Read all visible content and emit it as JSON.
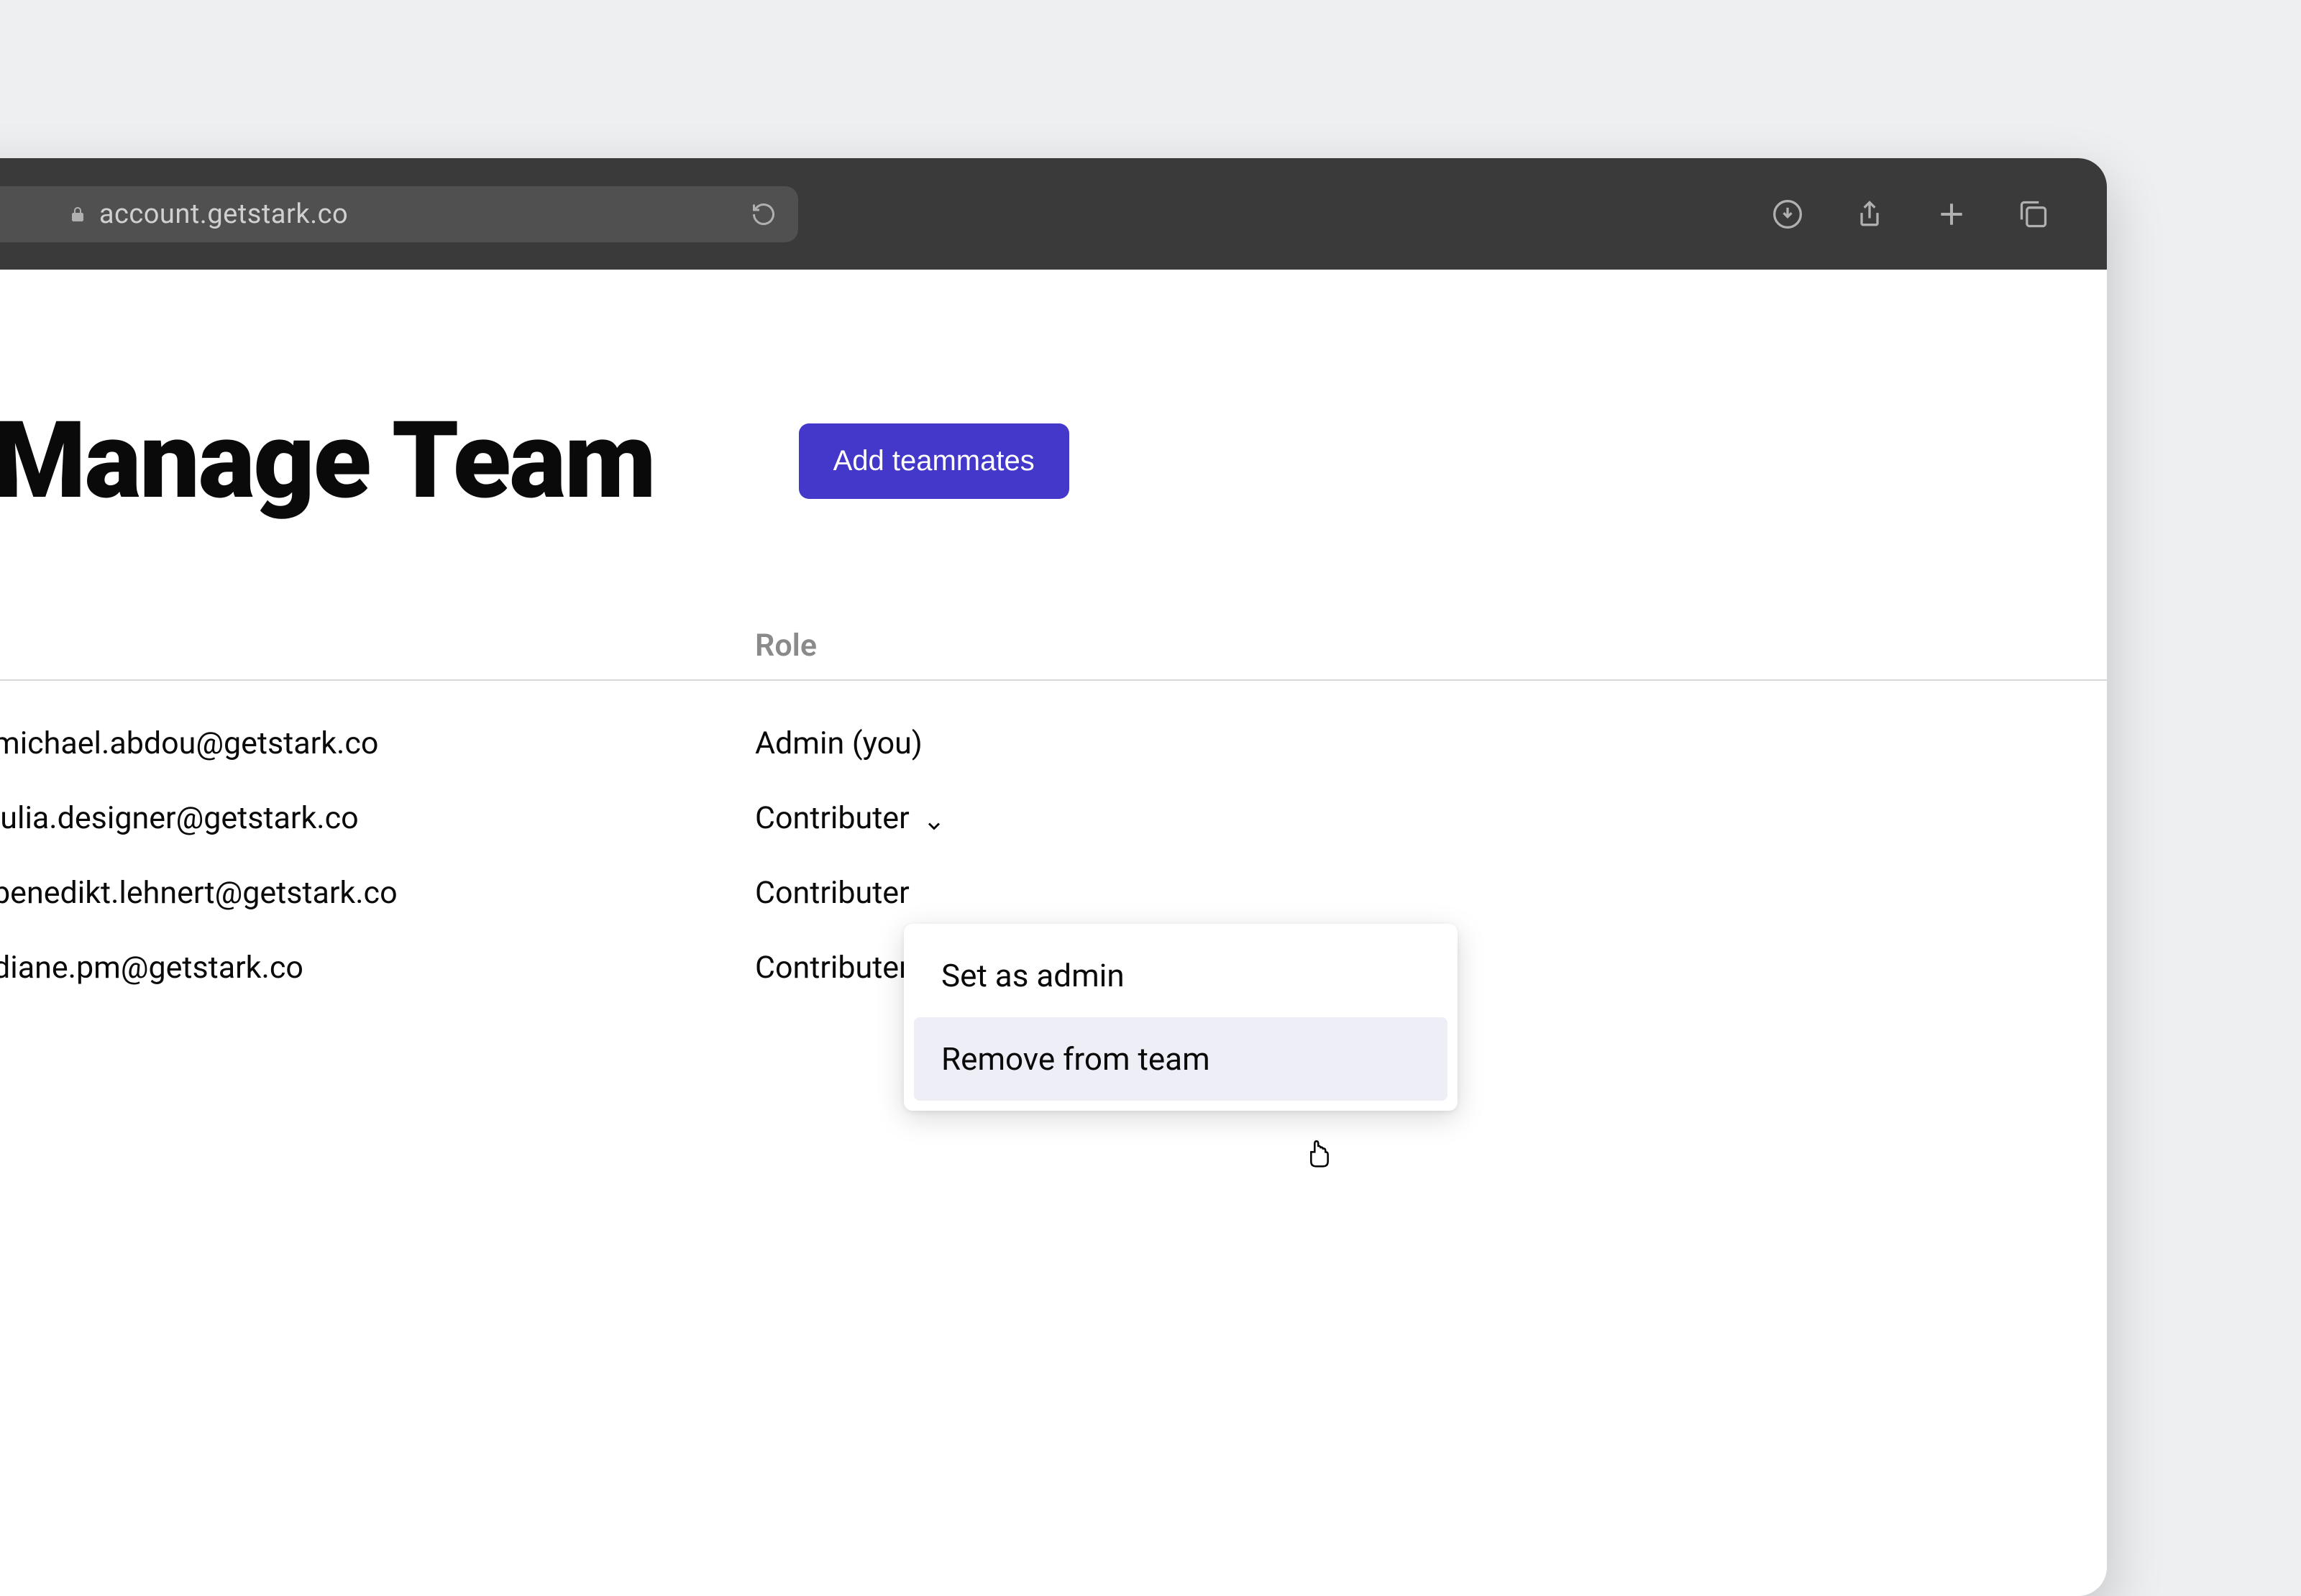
{
  "browser": {
    "url": "account.getstark.co"
  },
  "page": {
    "title": "Manage Team",
    "add_button": "Add teammates"
  },
  "table": {
    "role_header": "Role",
    "rows": [
      {
        "email": "michael.abdou@getstark.co",
        "role": "Admin (you)",
        "has_dropdown": false
      },
      {
        "email": "julia.designer@getstark.co",
        "role": "Contributer",
        "has_dropdown": true
      },
      {
        "email": "benedikt.lehnert@getstark.co",
        "role": "Contributer",
        "has_dropdown": true
      },
      {
        "email": "diane.pm@getstark.co",
        "role": "Contributer",
        "has_dropdown": true
      }
    ]
  },
  "dropdown": {
    "set_admin": "Set as admin",
    "remove": "Remove from team"
  }
}
